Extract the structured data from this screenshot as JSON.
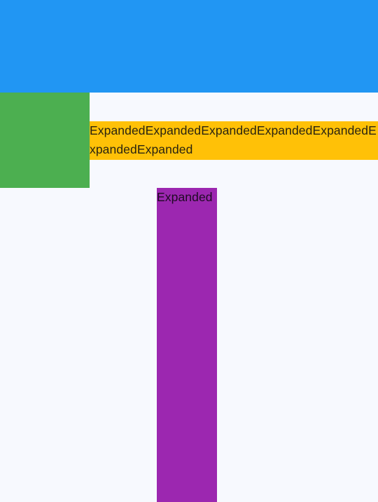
{
  "colors": {
    "background": "#f7f9fe",
    "top_bar": "#2196f3",
    "green": "#4caf50",
    "amber": "#ffc107",
    "purple": "#9c27b0"
  },
  "amber_block": {
    "text": "ExpandedExpandedExpandedExpandedExpandedExpandedExpanded"
  },
  "purple_block": {
    "text": "Expanded"
  }
}
